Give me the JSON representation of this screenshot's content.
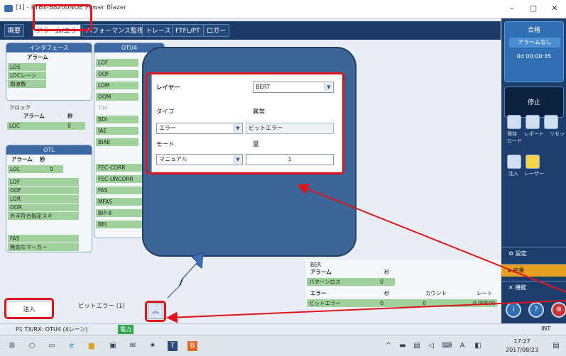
{
  "window": {
    "title": "[1] - FTBx-88200NGE Power Blazer"
  },
  "tabs": [
    "概要",
    "アラーム/エラー",
    "パフォーマンス監視",
    "トレース",
    "FTFL/PT",
    "ロガー"
  ],
  "status": {
    "verdict": "合格",
    "alarm_state": "アラームなし",
    "elapsed": "0d 00:00:35"
  },
  "stop_label": "停止",
  "side_icons": [
    "保存",
    "レポート",
    "リセット",
    "ロード",
    "注入",
    "レーザー"
  ],
  "side_menu": [
    "設定",
    "結果",
    "機能"
  ],
  "interface_panel": {
    "title": "インタフェース",
    "alarm_header": "アラーム",
    "alarms": [
      "LOS",
      "LOCレーン",
      "周波数"
    ]
  },
  "clock_panel": {
    "title": "クロック",
    "alarm_header": "アラーム",
    "sec_header": "秒",
    "row_label": "LOC",
    "row_value": "0"
  },
  "otl_panel": {
    "title": "OTL",
    "alarm_header": "アラーム",
    "sec_header": "秒",
    "lol_label": "LOL",
    "lol_value": "0",
    "alarms": [
      "LOF",
      "OOF",
      "LOR",
      "OOR",
      "外字符合指定スキ"
    ],
    "fas": "FAS",
    "fas_sub": "無効なマーカー"
  },
  "otu4_panel": {
    "title": "OTU4",
    "alarms": [
      "LOF",
      "OOF",
      "LOM",
      "OOM",
      "TIM",
      "BDI",
      "IAE",
      "BIAE"
    ],
    "errors": [
      "FEC-CORR",
      "FEC-UNCORR",
      "FAS",
      "MFAS",
      "BIP-8",
      "BEI"
    ]
  },
  "dialog": {
    "layer_label": "レイヤー",
    "layer_value": "BERT",
    "type_label": "タイプ",
    "anomaly_label": "異常",
    "type_value": "エラー",
    "anomaly_value": "ビットエラー",
    "mode_label": "モード",
    "amount_label": "量",
    "mode_value": "マニュアル",
    "amount_value": "1"
  },
  "ber": {
    "title": "BER",
    "alarm_header": "アラーム",
    "sec_header": "秒",
    "pattern_loss": "パターンロス",
    "pattern_loss_value": "0",
    "error_header": "エラー",
    "count_header": "カウント",
    "rate_header": "レート",
    "bit_error": "ビットエラー",
    "bit_error_sec": "0",
    "bit_error_count": "0",
    "bit_error_rate": "0.00E00"
  },
  "inject": {
    "label": "注入",
    "bit_error_text": "ビットエラー (1)"
  },
  "statusbar": {
    "text": "P1 TX/RX: OTU4 (4レーン)",
    "power": "電力",
    "int_label": "INT"
  },
  "taskbar": {
    "time": "17:27",
    "date": "2017/08/23",
    "ime": "A"
  },
  "colors": {
    "accent_red": "#e0141c",
    "navy": "#1c3a66",
    "alarm_green": "#9fd29a"
  }
}
